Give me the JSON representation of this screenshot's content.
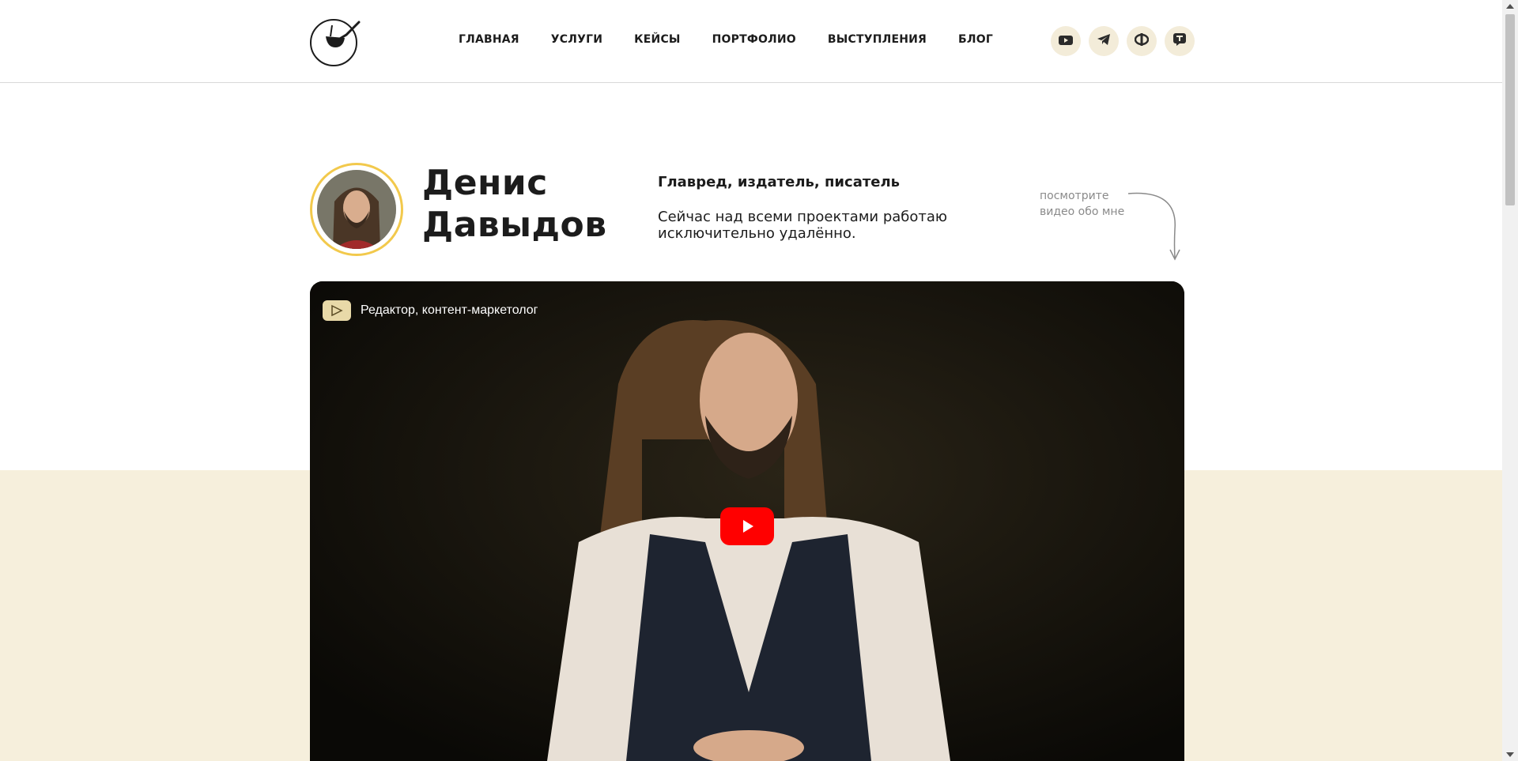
{
  "header": {
    "logo_icon": "pipe-checkmark-logo",
    "nav": [
      {
        "label": "ГЛАВНАЯ"
      },
      {
        "label": "УСЛУГИ"
      },
      {
        "label": "КЕЙСЫ"
      },
      {
        "label": "ПОРТФОЛИО"
      },
      {
        "label": "ВЫСТУПЛЕНИЯ"
      },
      {
        "label": "БЛОГ"
      }
    ],
    "socials": [
      {
        "icon": "youtube-icon"
      },
      {
        "icon": "telegram-icon"
      },
      {
        "icon": "vc-icon"
      },
      {
        "icon": "tenchat-icon"
      }
    ]
  },
  "hero": {
    "name_line1": "Денис",
    "name_line2": "Давыдов",
    "role": "Главред, издатель, писатель",
    "description": "Сейчас над всеми проектами работаю исключительно удалённо.",
    "video_hint": "посмотрите видео обо мне"
  },
  "video": {
    "title": "Редактор, контент-маркетолог",
    "play_icon": "youtube-play-icon"
  },
  "colors": {
    "accent_ring": "#f2c94c",
    "beige_band": "#f6efdc",
    "social_bg": "#f3ecd9",
    "youtube_red": "#ff0000"
  }
}
